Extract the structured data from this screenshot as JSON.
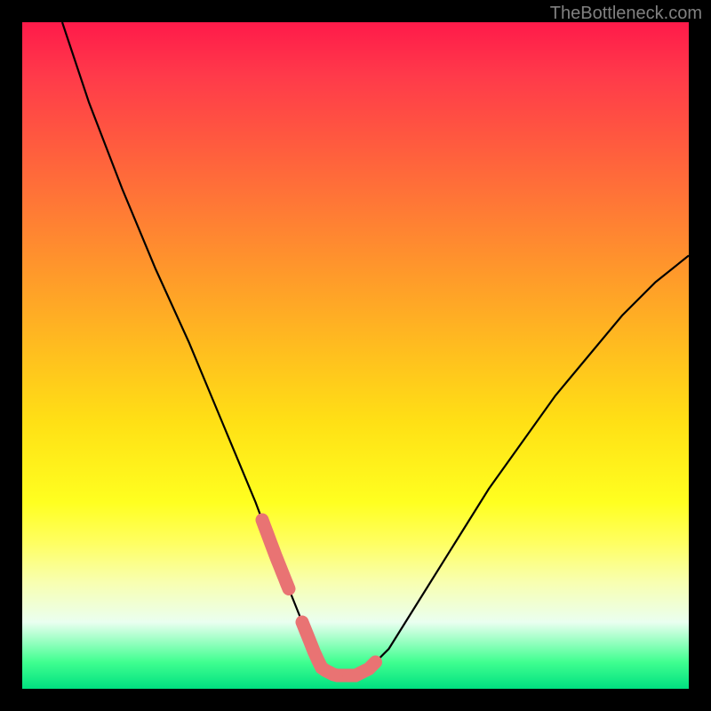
{
  "watermark": "TheBottleneck.com",
  "chart_data": {
    "type": "line",
    "title": "",
    "xlabel": "",
    "ylabel": "",
    "xlim": [
      0,
      100
    ],
    "ylim": [
      0,
      100
    ],
    "series": [
      {
        "name": "curve",
        "x": [
          6,
          10,
          15,
          20,
          25,
          30,
          35,
          38,
          40,
          42,
          44,
          45,
          47,
          48,
          50,
          52,
          55,
          60,
          65,
          70,
          75,
          80,
          85,
          90,
          95,
          100
        ],
        "values": [
          100,
          88,
          75,
          63,
          52,
          40,
          28,
          20,
          15,
          10,
          5,
          3,
          2,
          2,
          2,
          3,
          6,
          14,
          22,
          30,
          37,
          44,
          50,
          56,
          61,
          65
        ]
      }
    ],
    "markers": [
      {
        "name": "left-marker",
        "x_range": [
          36,
          40
        ],
        "style": "pink-dash"
      },
      {
        "name": "bottom-marker",
        "x_range": [
          42,
          49
        ],
        "style": "pink-dash"
      },
      {
        "name": "right-marker",
        "x_range": [
          49,
          53
        ],
        "style": "pink-dash"
      }
    ],
    "colors": {
      "curve": "#000000",
      "marker": "#e97373",
      "gradient_top": "#ff1a4a",
      "gradient_bottom": "#00e080"
    }
  }
}
